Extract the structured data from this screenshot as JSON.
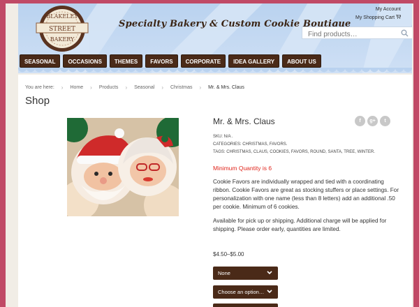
{
  "header": {
    "logo": {
      "line1": "BLAKELEY",
      "line2": "STREET",
      "line3": "BAKERY"
    },
    "tagline": "Specialty Bakery & Custom Cookie Boutique",
    "account_link": "My Account",
    "cart_link": "My Shopping Cart",
    "cart_icon": "cart-icon",
    "search_placeholder": "Find products…",
    "search_icon": "search-icon"
  },
  "nav": [
    "SEASONAL",
    "OCCASIONS",
    "THEMES",
    "FAVORS",
    "CORPORATE",
    "IDEA GALLERY",
    "ABOUT US"
  ],
  "breadcrumb": {
    "prefix": "You are here:",
    "items": [
      "Home",
      "Products",
      "Seasonal",
      "Christmas"
    ],
    "current": "Mr. & Mrs. Claus"
  },
  "page_title": "Shop",
  "product": {
    "title": "Mr. & Mrs. Claus",
    "sku": "SKU: N/A .",
    "categories": "CATEGORIES: CHRISTMAS, FAVORS.",
    "tags": "TAGS: CHRISTMAS, CLAUS, COOKIES, FAVORS, ROUND, SANTA, TREE, WINTER.",
    "min_qty": "Minimum Quantity is 6",
    "desc1": "Cookie Favors are individually wrapped and tied with a coordinating ribbon. Cookie Favors are great as stocking stuffers or place settings. For personalization with one name (less than 8 letters) add an additional .50 per cookie. Minimum of 6 cookies.",
    "desc2": "Available for pick up or shipping. Additional charge will be applied for shipping. Please order early, quantities are limited.",
    "price": "$4.50–$5.00",
    "option1": "None",
    "option2": "Choose an option…"
  },
  "social": [
    "f",
    "g+",
    "t"
  ],
  "colors": {
    "frame": "#c04a66",
    "nav": "#4a2a18",
    "accent_red": "#e0261d",
    "header_blue": "#b9d2ef"
  }
}
